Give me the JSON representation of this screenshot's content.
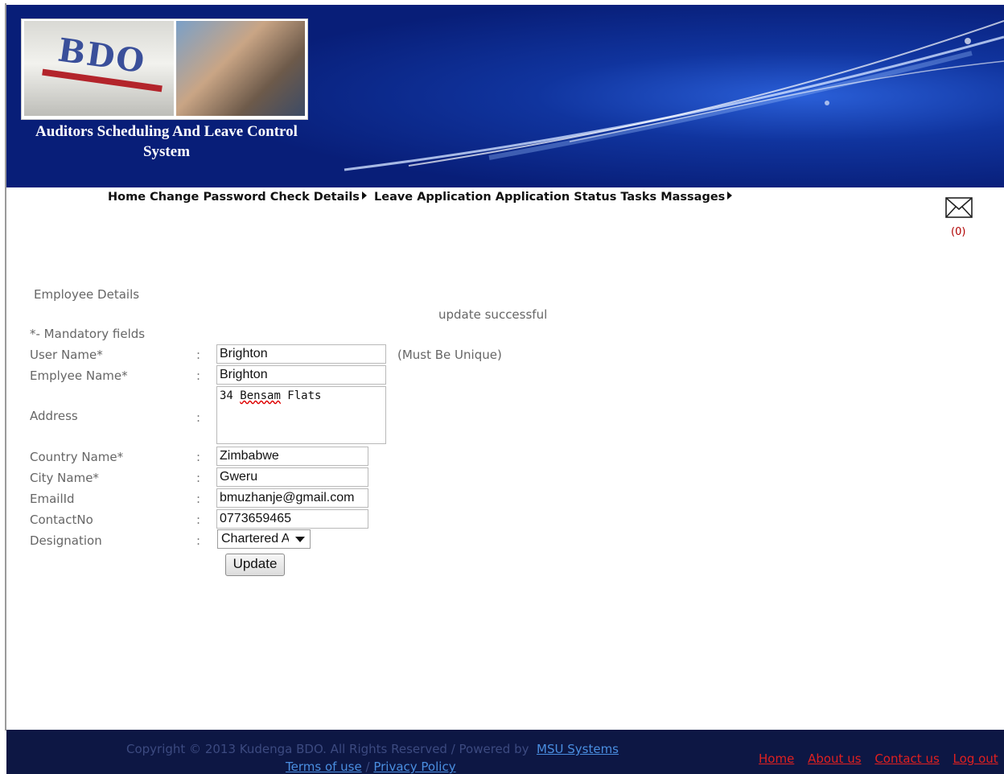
{
  "header": {
    "title": "Auditors Scheduling And Leave Control System",
    "logo_text": "BDO"
  },
  "nav": {
    "items": [
      "Home",
      "Change Password",
      "Check Details",
      "Leave Application",
      "Application Status",
      "Tasks",
      "Massages"
    ]
  },
  "mail": {
    "count": "(0)",
    "icon": "mail-icon"
  },
  "form": {
    "section_title": "Employee Details",
    "status_message": "update successful",
    "mandatory_note": "*- Mandatory fields",
    "colon": ":",
    "fields": {
      "user_name": {
        "label": "User Name*",
        "value": "Brighton",
        "hint": "(Must Be Unique)"
      },
      "employee_name": {
        "label": "Emplyee Name*",
        "value": "Brighton"
      },
      "address": {
        "label": "Address",
        "value_prefix": "34 ",
        "value_misspelled": "Bensam",
        "value_suffix": " Flats"
      },
      "country": {
        "label": "Country Name*",
        "value": "Zimbabwe"
      },
      "city": {
        "label": "City Name*",
        "value": "Gweru"
      },
      "email": {
        "label": "EmailId",
        "value": "bmuzhanje@gmail.com"
      },
      "contact": {
        "label": "ContactNo",
        "value": "0773659465"
      },
      "designation": {
        "label": "Designation",
        "value": "Chartered A"
      }
    },
    "submit_label": "Update"
  },
  "footer": {
    "copyright_prefix": "Copyright © 2013 Kudenga BDO. All Rights Reserved / Powered by",
    "powered_link": "MSU Systems",
    "terms": "Terms of use",
    "separator": "/",
    "privacy": "Privacy Policy",
    "links": [
      "Home",
      "About us",
      "Contact us",
      "Log out"
    ]
  }
}
